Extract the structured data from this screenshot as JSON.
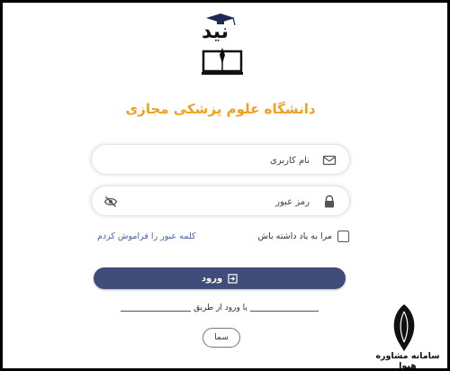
{
  "brand": {
    "logo_text": "نید"
  },
  "title": "دانشگاه علوم پزشکی مجازی",
  "username": {
    "placeholder": "نام کاربری",
    "icon": "mail-icon"
  },
  "password": {
    "placeholder": "رمز عبور",
    "icon": "lock-icon",
    "toggle_icon": "eye-slash-icon"
  },
  "remember_label": "مرا به یاد داشته باش",
  "forgot_link": "کلمه عبور را فراموش کردم",
  "login_button": "ورود",
  "divider_text": "یا ورود از طریق",
  "sama_button": "سما",
  "watermark": {
    "text": "سامانه مشاوره هیوا"
  },
  "colors": {
    "title": "#f0a020",
    "button": "#3f4d78",
    "link": "#4a5fa8"
  }
}
